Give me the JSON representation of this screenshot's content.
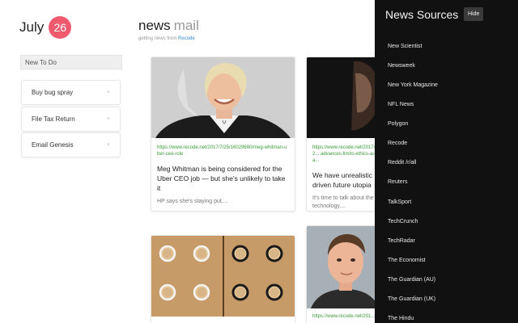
{
  "date": {
    "month": "July",
    "day": "26",
    "accent": "#ef5a6f"
  },
  "header": {
    "brand_news": "news",
    "brand_mail": "mail",
    "subtitle_prefix": "getting news from",
    "subtitle_source": "Recode"
  },
  "todo": {
    "placeholder": "New To Do",
    "items": [
      {
        "label": "Buy bug spray",
        "close": "×"
      },
      {
        "label": "File Tax Return",
        "close": "×"
      },
      {
        "label": "Email Genesis",
        "close": "×"
      }
    ]
  },
  "cards": [
    {
      "url": "https://www.recode.net/2017/7/25/16029680/meg-whitman-uber-ceo-role",
      "title": "Meg Whitman is being considered for the Uber CEO job — but she's unlikely to take it",
      "desc": "HP says she's staying put...."
    },
    {
      "url": "https://www.recode.net/2017/7/2... advances-limits-ethics-ai-a...",
      "title": "We have unrealistic ... driven future utopia",
      "desc": "It's time to talk about the ... technology...."
    },
    {
      "url": "",
      "title": "",
      "desc": ""
    },
    {
      "url": "https://www.recode.net/201...",
      "title": "",
      "desc": ""
    }
  ],
  "panel": {
    "title": "News Sources",
    "hide_label": "Hide",
    "sources": [
      "New Scientist",
      "Newsweek",
      "New York Magazine",
      "NFL News",
      "Polygon",
      "Recode",
      "Reddit /r/all",
      "Reuters",
      "TalkSport",
      "TechCrunch",
      "TechRadar",
      "The Economist",
      "The Guardian (AU)",
      "The Guardian (UK)",
      "The Hindu"
    ]
  }
}
